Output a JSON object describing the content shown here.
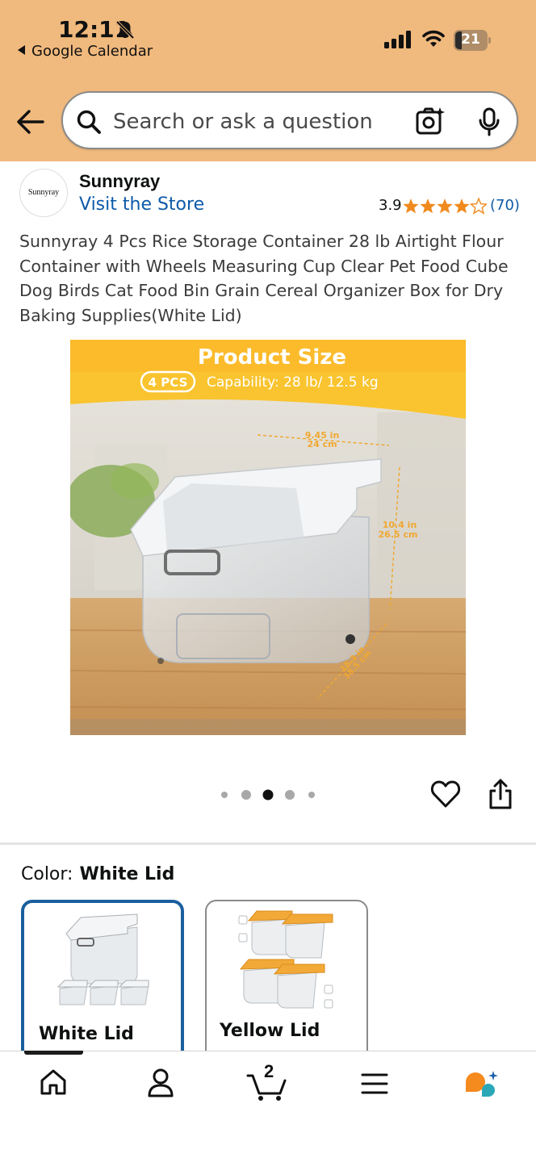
{
  "status_bar": {
    "time": "12:11",
    "back_app": "Google Calendar",
    "battery": "21"
  },
  "search": {
    "placeholder": "Search or ask a question"
  },
  "brand": {
    "logo_text": "Sunnyray",
    "name": "Sunnyray",
    "visit_store": "Visit the Store",
    "rating": "3.9",
    "rating_value": 3.9,
    "review_count": "(70)"
  },
  "product": {
    "title": "Sunnyray 4 Pcs Rice Storage Container 28 lb Airtight Flour Container with Wheels Measuring Cup Clear Pet Food Cube Dog Birds Cat Food Bin Grain Cereal Organizer Box for Dry Baking Supplies(White Lid)",
    "image": {
      "heading": "Product Size",
      "badge": "4 PCS",
      "capability": "Capability:  28 lb/ 12.5 kg",
      "dim_width_in": "9.45 in",
      "dim_width_cm": "24 cm",
      "dim_height_in": "10.4 in",
      "dim_height_cm": "26.5 cm",
      "dim_depth_in": "15.2 in",
      "dim_depth_cm": "38.5 cm"
    },
    "carousel": {
      "total": 5,
      "active_index": 2
    }
  },
  "color": {
    "label": "Color:",
    "selected": "White Lid",
    "options": [
      {
        "label": "White Lid",
        "selected": true
      },
      {
        "label": "Yellow Lid",
        "selected": false
      }
    ]
  },
  "tabbar": {
    "cart_count": "2",
    "items": [
      "home-icon",
      "account-icon",
      "cart-icon",
      "menu-icon",
      "rufus-icon"
    ]
  },
  "colors": {
    "header_bg": "#f0b97d",
    "link": "#0d5aa8",
    "star": "#f08a1d",
    "selected_border": "#1a5f9e",
    "banner_yellow": "#f9c42f"
  }
}
